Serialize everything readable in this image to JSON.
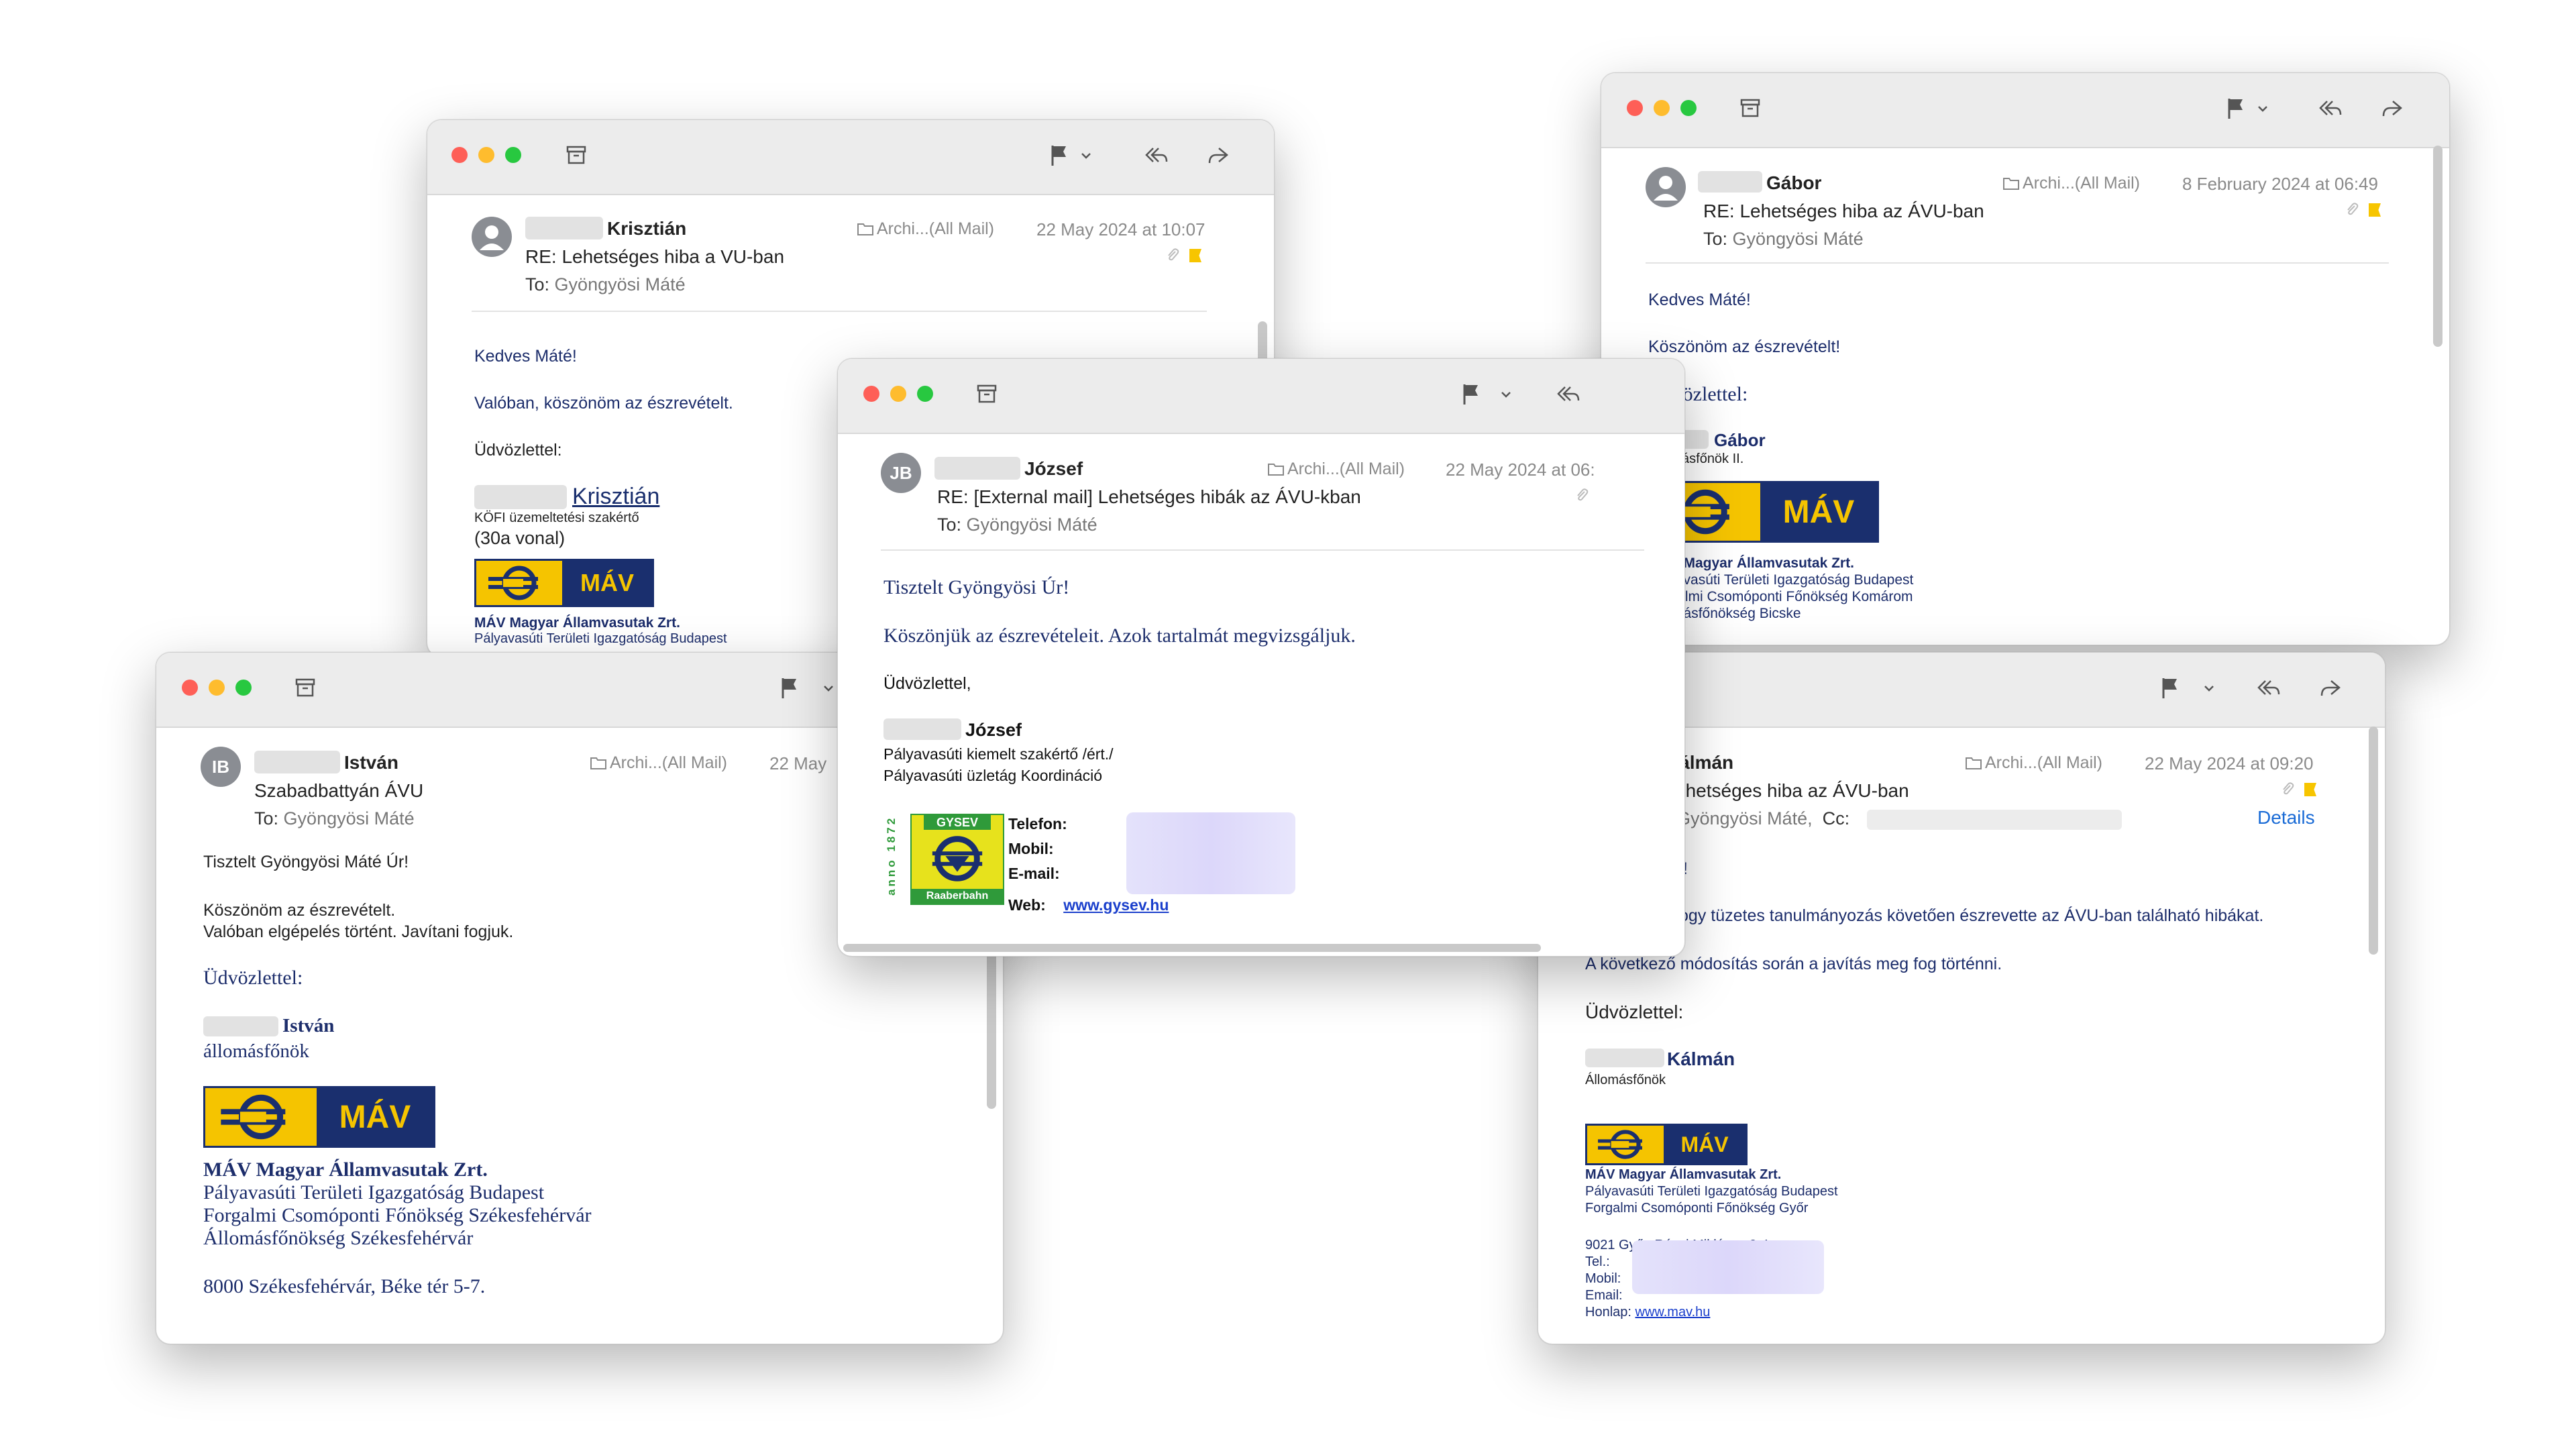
{
  "icons": [
    "archive-icon",
    "flag-icon",
    "chevron-down-icon",
    "reply-all-icon",
    "forward-icon",
    "folder-icon",
    "paperclip-icon",
    "flag-badge-icon",
    "person-icon"
  ],
  "colors": {
    "mav_blue": "#1a2f6e",
    "mav_yellow": "#f5c400",
    "link_blue": "#1a6bd6",
    "body_navy": "#1c2d6b",
    "gysev_green": "#2f9a3a"
  },
  "common": {
    "folder": "Archi...(All Mail)",
    "to_label": "To:",
    "to_name": "Gyöngyösi Máté",
    "cc_label": "Cc:",
    "details": "Details"
  },
  "krisztian": {
    "sender": "Krisztián",
    "subject": "RE: Lehetséges hiba a VU-ban",
    "date": "22 May 2024 at 10:07",
    "lines": [
      "Kedves Máté!",
      "Valóban, köszönöm az észrevételt.",
      "Üdvözlettel:"
    ],
    "sig_name": "Krisztián",
    "sig_title": "KÖFI üzemeltetési szakértő",
    "sig_line": "(30a vonal)",
    "mav": "MÁV",
    "company": "MÁV Magyar Államvasutak Zrt.",
    "dept": "Pályavasúti Területi Igazgatóság Budapest"
  },
  "jozsef": {
    "initials": "JB",
    "sender": "József",
    "subject": "RE: [External mail] Lehetséges hibák az ÁVU-kban",
    "date": "22 May 2024 at 06:",
    "greeting": "Tisztelt Gyöngyösi Úr!",
    "line1": "Köszönjük az észrevételeit. Azok tartalmát megvizsgáljuk.",
    "closing": "Üdvözlettel,",
    "sig_name": "József",
    "sig_title": "Pályavasúti kiemelt szakértő /ért./",
    "sig_dept": "Pályavasúti üzletág Koordináció",
    "telefon": "Telefon:",
    "mobil": "Mobil:",
    "email": "E-mail:",
    "web": "Web:",
    "web_url": "www.gysev.hu",
    "gysev_name": "GYSEV",
    "gysev_year": "anno 1872",
    "gysev_sub": "Raaberbahn"
  },
  "gabor": {
    "sender": "Gábor",
    "subject": "RE: Lehetséges hiba az ÁVU-ban",
    "date": "8 February 2024 at 06:49",
    "lines": [
      "Kedves Máté!",
      "Köszönöm az észrevételt!",
      "Üdvözlettel:"
    ],
    "sig_name": "Gábor",
    "sig_title": "Állomásfőnök II.",
    "mav": "MÁV",
    "company": "MÁV Magyar Államvasutak Zrt.",
    "dept1": "Pályavasúti Területi Igazgatóság Budapest",
    "dept2": "Forgalmi Csomóponti Főnökség Komárom",
    "dept3": "Állomásfőnökség Bicske"
  },
  "istvan": {
    "initials": "IB",
    "sender": "István",
    "subject": "Szabadbattyán ÁVU",
    "date": "22 May",
    "greeting": "Tisztelt Gyöngyösi Máté Úr!",
    "line1": "Köszönöm az észrevételt.",
    "line2": "Valóban elgépelés történt. Javítani fogjuk.",
    "closing": "Üdvözlettel:",
    "sig_name": "István",
    "sig_title": "állomásfőnök",
    "mav": "MÁV",
    "company": "MÁV Magyar Államvasutak Zrt.",
    "dept1": "Pályavasúti Területi Igazgatóság Budapest",
    "dept2": "Forgalmi Csomóponti Főnökség Székesfehérvár",
    "dept3": "Állomásfőnökség Székesfehérvár",
    "address": "8000 Székesfehérvár, Béke tér 5-7."
  },
  "kalman": {
    "sender": "Kálmán",
    "subject": "ehetséges hiba az ÁVU-ban",
    "date": "22 May 2024 at 09:20",
    "to_name": "Gyöngyösi Máté,",
    "greet_frag": "!",
    "line1": "ogy tüzetes tanulmányozás követően észrevette az ÁVU-ban található hibákat.",
    "line2": "A következő módosítás során a javítás meg fog történni.",
    "closing": "Üdvözlettel:",
    "sig_name": "Kálmán",
    "sig_title": "Állomásfőnök",
    "mav": "MÁV",
    "company": "MÁV Magyar Államvasutak Zrt.",
    "dept1": "Pályavasúti Területi Igazgatóság Budapest",
    "dept2": "Forgalmi Csomóponti Főnökség Győr",
    "address": "9021 Győr, Révai Miklós u. 2-4.",
    "tel": "Tel.:",
    "mobil": "Mobil:",
    "email": "Email:",
    "honlap": "Honlap:",
    "honlap_url": "www.mav.hu"
  }
}
